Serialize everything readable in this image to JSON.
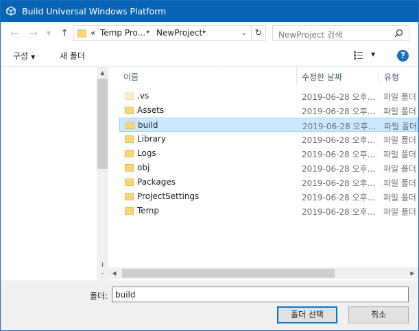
{
  "window": {
    "title": "Build Universal Windows Platform"
  },
  "nav": {
    "back_icon": "arrow-left-icon",
    "forward_icon": "arrow-right-icon",
    "up_icon": "arrow-up-icon",
    "address": {
      "overflow": "«",
      "crumb1": "Temp Pro...",
      "crumb2": "NewProject"
    },
    "search_placeholder": "NewProject 검색"
  },
  "toolbar": {
    "organize_label": "구성",
    "new_folder_label": "새 폴더"
  },
  "columns": {
    "name": "이름",
    "date": "수정한 날짜",
    "type": "유형"
  },
  "files": [
    {
      "name": ".vs",
      "date": "2019-06-28 오후...",
      "type": "파일 폴더",
      "light": true
    },
    {
      "name": "Assets",
      "date": "2019-06-28 오후...",
      "type": "파일 폴더"
    },
    {
      "name": "build",
      "date": "2019-06-28 오후...",
      "type": "파일 폴더",
      "selected": true
    },
    {
      "name": "Library",
      "date": "2019-06-28 오후...",
      "type": "파일 폴더"
    },
    {
      "name": "Logs",
      "date": "2019-06-28 오후...",
      "type": "파일 폴더"
    },
    {
      "name": "obj",
      "date": "2019-06-28 오후...",
      "type": "파일 폴더"
    },
    {
      "name": "Packages",
      "date": "2019-06-28 오후...",
      "type": "파일 폴더"
    },
    {
      "name": "ProjectSettings",
      "date": "2019-06-28 오후...",
      "type": "파일 폴더"
    },
    {
      "name": "Temp",
      "date": "2019-06-28 오후...",
      "type": "파일 폴더"
    }
  ],
  "bottom": {
    "folder_label": "폴더:",
    "folder_value": "build",
    "select_button": "폴더 선택",
    "cancel_button": "취소"
  },
  "colors": {
    "titlebar": "#0a64b6",
    "selection": "#cce8ff",
    "folder": "#f8d775",
    "help": "#1a6ec2"
  }
}
